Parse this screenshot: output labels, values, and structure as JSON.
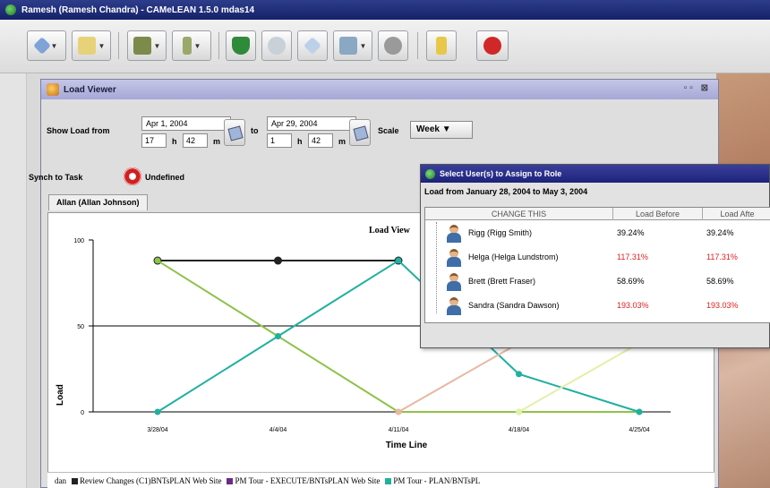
{
  "app": {
    "title": "Ramesh (Ramesh Chandra) - CAMeLEAN 1.5.0 mdas14"
  },
  "toolbar": {
    "buttons": [
      {
        "icon": "arrow-icon",
        "has_menu": true
      },
      {
        "icon": "folder-icon",
        "has_menu": true
      },
      {
        "icon": "database-icon",
        "has_menu": true
      },
      {
        "icon": "person-icon",
        "has_menu": true
      },
      {
        "icon": "shield-icon",
        "has_menu": false
      },
      {
        "icon": "network-icon",
        "has_menu": false
      },
      {
        "icon": "tag-icon",
        "has_menu": false
      },
      {
        "icon": "chart-icon",
        "has_menu": true
      },
      {
        "icon": "gear-icon",
        "has_menu": false
      },
      {
        "icon": "help-icon",
        "has_menu": false
      },
      {
        "icon": "exit-icon",
        "has_menu": false
      }
    ]
  },
  "load_viewer": {
    "title": "Load Viewer",
    "show_load_from_label": "Show Load from",
    "from_date": "Apr 1, 2004",
    "from_hour": "17",
    "from_min": "42",
    "h_label": "h",
    "m_label": "m",
    "to_label": "to",
    "to_date": "Apr 29, 2004",
    "to_hour": "1",
    "to_min": "42",
    "scale_label": "Scale",
    "scale_value": "Week",
    "synch_label": "Synch to Task",
    "synch_value": "Undefined",
    "tab_label": "Allan (Allan Johnson)"
  },
  "chart_data": {
    "type": "line",
    "title": "Load View",
    "xlabel": "Time Line",
    "ylabel": "Load",
    "categories": [
      "3/28/04",
      "4/4/04",
      "4/11/04",
      "4/18/04",
      "4/25/04"
    ],
    "y_ticks": [
      "0",
      "50",
      "100"
    ],
    "ylim": [
      0,
      100
    ],
    "series": [
      {
        "name": "Review Changes (C1)BNTsPLAN Web Site",
        "color": "#222222",
        "values": [
          88,
          88,
          88,
          null,
          null
        ]
      },
      {
        "name": "PM Tour - EXECUTE/BNTsPLAN Web Site",
        "color": "#8fc24a",
        "values": [
          88,
          44,
          0,
          0,
          0
        ]
      },
      {
        "name": "PM Tour - PLAN/BNTsPLAN Web Site",
        "color": "#20b0a0",
        "values": [
          0,
          44,
          88,
          22,
          0
        ]
      },
      {
        "color": "#e7b9a3",
        "values": [
          null,
          null,
          0,
          40,
          null
        ]
      },
      {
        "color": "#e4f0a8",
        "values": [
          null,
          null,
          null,
          0,
          40
        ]
      }
    ],
    "legend": [
      {
        "label": "Review Changes (C1)BNTsPLAN Web Site",
        "color": "#222222"
      },
      {
        "label": "PM Tour - EXECUTE/BNTsPLAN Web Site",
        "color": "#6b2a8a"
      },
      {
        "label": "PM Tour - PLAN/BNTsPL",
        "color": "#20b0a0"
      }
    ],
    "legend_prefix": "dan",
    "grid": false,
    "legend_position": "bottom"
  },
  "dialog": {
    "title": "Select User(s) to Assign to Role",
    "subtitle": "Load from January 28, 2004 to May 3, 2004",
    "columns": [
      "CHANGE THIS",
      "Load Before",
      "Load Afte"
    ],
    "rows": [
      {
        "name": "Rigg (Rigg Smith)",
        "before": "39.24%",
        "after": "39.24%",
        "over": false
      },
      {
        "name": "Helga (Helga Lundstrom)",
        "before": "117.31%",
        "after": "117.31%",
        "over": true
      },
      {
        "name": "Brett (Brett Fraser)",
        "before": "58.69%",
        "after": "58.69%",
        "over": false
      },
      {
        "name": "Sandra (Sandra Dawson)",
        "before": "193.03%",
        "after": "193.03%",
        "over": true
      }
    ]
  }
}
